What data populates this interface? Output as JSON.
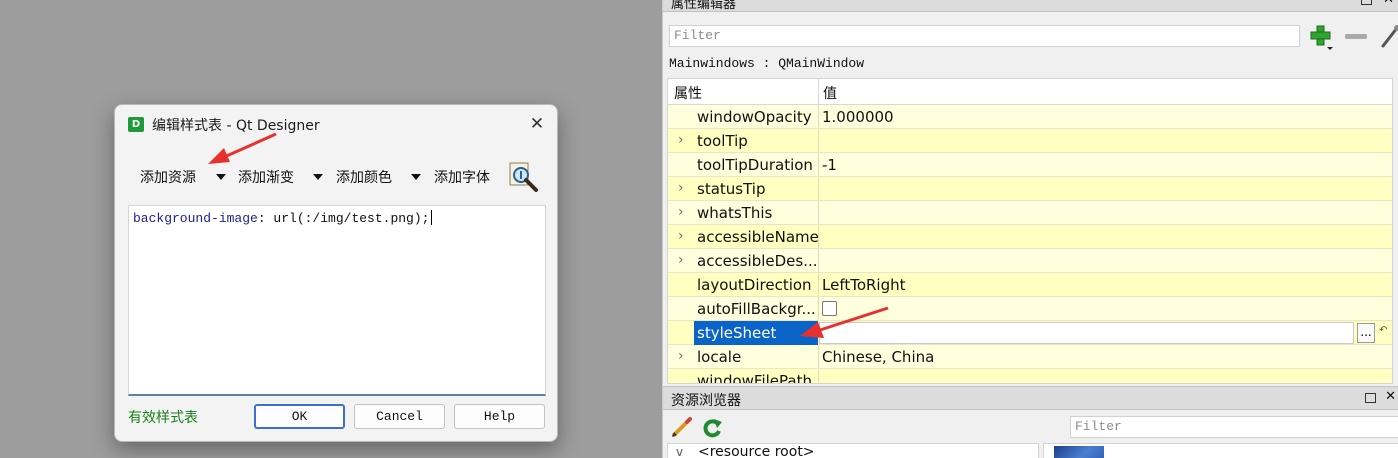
{
  "dialog": {
    "title": "编辑样式表 - Qt Designer",
    "app_icon_letter": "D",
    "close_glyph": "✕",
    "toolbar": {
      "add_resource": "添加资源",
      "add_gradient": "添加渐变",
      "add_color": "添加颜色",
      "add_font": "添加字体"
    },
    "editor": {
      "property": "background-image",
      "value": ": url(:/img/test.png);"
    },
    "status": "有效样式表",
    "buttons": {
      "ok": "OK",
      "cancel": "Cancel",
      "help": "Help"
    }
  },
  "property_editor": {
    "title": "属性编辑器",
    "filter_placeholder": "Filter",
    "object_label": "Mainwindows : QMainWindow",
    "header": {
      "property": "属性",
      "value": "值"
    },
    "rows": [
      {
        "name": "windowOpacity",
        "value": "1.000000",
        "expandable": false
      },
      {
        "name": "toolTip",
        "value": "",
        "expandable": true
      },
      {
        "name": "toolTipDuration",
        "value": "-1",
        "expandable": false
      },
      {
        "name": "statusTip",
        "value": "",
        "expandable": true
      },
      {
        "name": "whatsThis",
        "value": "",
        "expandable": true
      },
      {
        "name": "accessibleName",
        "value": "",
        "expandable": true
      },
      {
        "name": "accessibleDes...",
        "value": "",
        "expandable": true
      },
      {
        "name": "layoutDirection",
        "value": "LeftToRight",
        "expandable": false
      },
      {
        "name": "autoFillBackgr...",
        "value": "",
        "checkbox": true,
        "checked": false
      },
      {
        "name": "styleSheet",
        "value": "",
        "selected": true,
        "dots_label": "..."
      },
      {
        "name": "locale",
        "value": "Chinese, China",
        "expandable": true
      },
      {
        "name": "windowFilePath",
        "value": "",
        "expandable": false
      }
    ],
    "chevron_glyph": "›",
    "reset_glyph": "↶"
  },
  "resource_browser": {
    "title": "资源浏览器",
    "filter_placeholder": "Filter",
    "tree_root": "<resource root>",
    "tree_chevron": "v"
  },
  "colors": {
    "selection": "#0a64c8",
    "row_alt_a": "#ffffde",
    "row_alt_b": "#ffffc1",
    "annotation_arrow": "#e8312f",
    "valid_status": "#1a7f1a"
  }
}
